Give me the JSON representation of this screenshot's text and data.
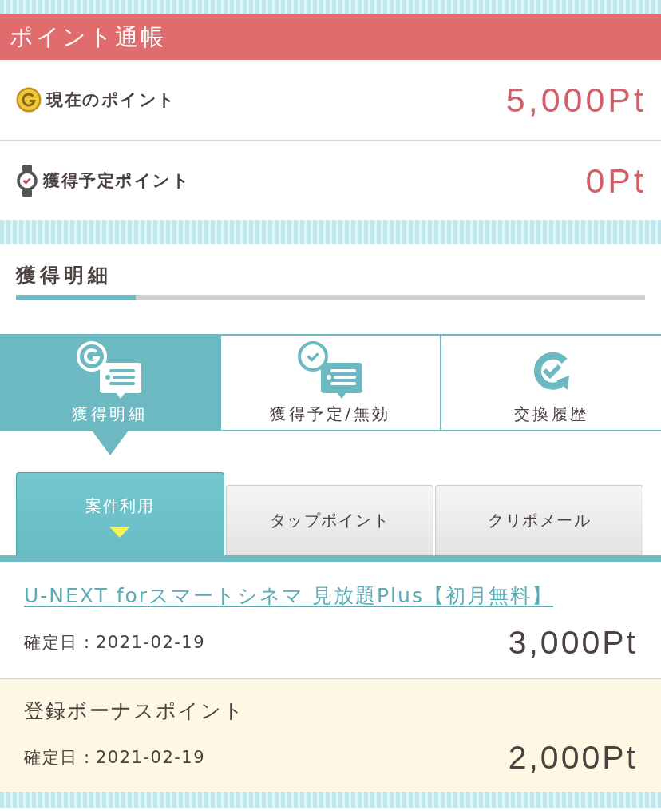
{
  "header": {
    "title": "ポイント通帳"
  },
  "balances": [
    {
      "kind": "current",
      "label": "現在のポイント",
      "value": "5,000Pt"
    },
    {
      "kind": "pending",
      "label": "獲得予定ポイント",
      "value": "0Pt"
    }
  ],
  "section": {
    "title": "獲得明細"
  },
  "main_tabs": [
    {
      "kind": "earned",
      "label": "獲得明細",
      "selected": true
    },
    {
      "kind": "pending",
      "label": "獲得予定/無効",
      "selected": false
    },
    {
      "kind": "exchange",
      "label": "交換履歴",
      "selected": false
    }
  ],
  "sub_tabs": [
    {
      "label": "案件利用",
      "selected": true
    },
    {
      "label": "タップポイント",
      "selected": false
    },
    {
      "label": "クリポメール",
      "selected": false
    }
  ],
  "entries": [
    {
      "kind": "link",
      "title": "U-NEXT forスマートシネマ 見放題Plus【初月無料】",
      "date": "確定日：2021-02-19",
      "points": "3,000Pt"
    },
    {
      "kind": "bonus",
      "title": "登録ボーナスポイント",
      "date": "確定日：2021-02-19",
      "points": "2,000Pt"
    }
  ]
}
